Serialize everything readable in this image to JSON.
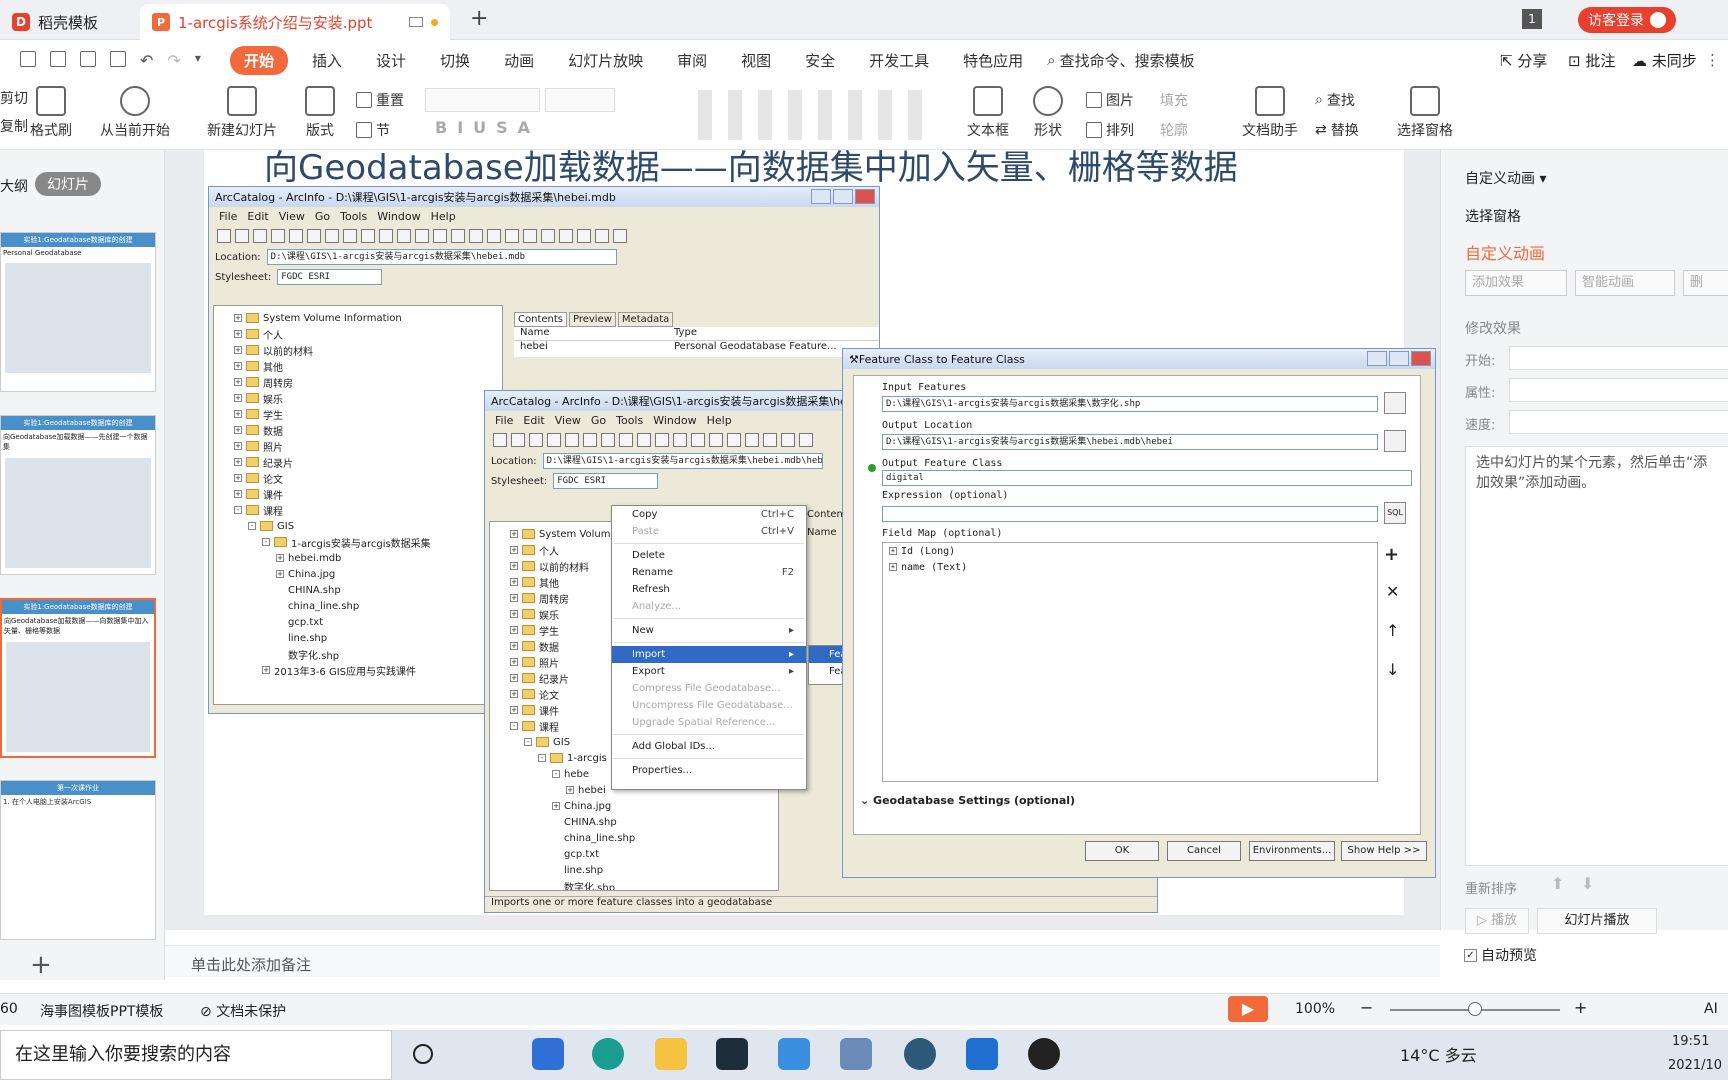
{
  "tabs": {
    "docer": "稻壳模板",
    "file": "1-arcgis系统介绍与安装.ppt",
    "badge": "1",
    "login": "访客登录"
  },
  "menu": {
    "start": "开始",
    "items": [
      "插入",
      "设计",
      "切换",
      "动画",
      "幻灯片放映",
      "审阅",
      "视图",
      "安全",
      "开发工具",
      "特色应用"
    ],
    "search": "查找命令、搜索模板",
    "share": "分享",
    "comment": "批注",
    "sync": "未同步"
  },
  "ribbon": {
    "cut": "剪切",
    "copy": "复制",
    "format_brush": "格式刷",
    "from_current": "从当前开始",
    "new_slide": "新建幻灯片",
    "layout": "版式",
    "reset": "重置",
    "section": "节",
    "textbox": "文本框",
    "shape": "形状",
    "picture": "图片",
    "arrange": "排列",
    "fill": "填充",
    "outline": "轮廓",
    "doc_helper": "文档助手",
    "find": "查找",
    "replace": "替换",
    "select_pane": "选择窗格"
  },
  "leftpanel": {
    "tab_outline": "大纲",
    "tab_slides": "幻灯片",
    "thumbs": [
      {
        "header": "实验1:Geodatabase数据库的创建",
        "sub": "Personal Geodatabase"
      },
      {
        "header": "实验1:Geodatabase数据库的创建",
        "sub": "向Geodatabase加载数据——先创建一个数据集"
      },
      {
        "header": "实验1:Geodatabase数据库的创建",
        "sub": "向Geodatabase加载数据——向数据集中加入矢量、栅格等数据"
      },
      {
        "header": "第一次课作业",
        "sub": "1. 在个人电脑上安装ArcGIS"
      }
    ],
    "add": "+"
  },
  "slide": {
    "title": "向Geodatabase加载数据——向数据集中加入矢量、栅格等数据"
  },
  "win1": {
    "title": "ArcCatalog - ArcInfo - D:\\课程\\GIS\\1-arcgis安装与arcgis数据采集\\hebei.mdb",
    "menu": [
      "File",
      "Edit",
      "View",
      "Go",
      "Tools",
      "Window",
      "Help"
    ],
    "location_label": "Location:",
    "location": "D:\\课程\\GIS\\1-arcgis安装与arcgis数据采集\\hebei.mdb",
    "stylesheet_label": "Stylesheet:",
    "stylesheet": "FGDC ESRI",
    "tabs": [
      "Contents",
      "Preview",
      "Metadata"
    ],
    "col_name": "Name",
    "col_type": "Type",
    "row_name": "hebei",
    "row_type": "Personal Geodatabase Feature...",
    "tree": [
      "System Volume Information",
      "个人",
      "以前的材料",
      "其他",
      "周转房",
      "娱乐",
      "学生",
      "数据",
      "照片",
      "纪录片",
      "论文",
      "课件",
      "课程",
      "GIS",
      "1-arcgis安装与arcgis数据采集",
      "hebei.mdb",
      "China.jpg",
      "CHINA.shp",
      "china_line.shp",
      "gcp.txt",
      "line.shp",
      "数字化.shp",
      "2013年3-6 GIS应用与实践课件"
    ]
  },
  "win2": {
    "title": "ArcCatalog - ArcInfo - D:\\课程\\GIS\\1-arcgis安装与arcgis数据采集\\hebei.m",
    "menu": [
      "File",
      "Edit",
      "View",
      "Go",
      "Tools",
      "Window",
      "Help"
    ],
    "location_label": "Location:",
    "location": "D:\\课程\\GIS\\1-arcgis安装与arcgis数据采集\\hebei.mdb\\hebei",
    "stylesheet_label": "Stylesheet:",
    "stylesheet": "FGDC ESRI",
    "contents_tab": "Contents",
    "name_col": "Name",
    "tree": [
      "System Volume",
      "个人",
      "以前的材料",
      "其他",
      "周转房",
      "娱乐",
      "学生",
      "数据",
      "照片",
      "纪录片",
      "论文",
      "课件",
      "课程",
      "GIS",
      "1-arcgis",
      "hebe",
      "hebei",
      "China.jpg",
      "CHINA.shp",
      "china_line.shp",
      "gcp.txt",
      "line.shp",
      "数字化.shp"
    ],
    "status": "Imports one or more feature classes into a geodatabase"
  },
  "ctx": {
    "copy": "Copy",
    "copy_sc": "Ctrl+C",
    "paste": "Paste",
    "paste_sc": "Ctrl+V",
    "delete": "Delete",
    "rename": "Rename",
    "rename_sc": "F2",
    "refresh": "Refresh",
    "analyze": "Analyze...",
    "new": "New",
    "import": "Import",
    "export": "Export",
    "compress": "Compress File Geodatabase...",
    "uncompress": "Uncompress File Geodatabase...",
    "upgrade": "Upgrade Spatial Reference...",
    "add_ids": "Add Global IDs...",
    "properties": "Properties...",
    "sub1": "Fea",
    "sub2": "Fea"
  },
  "dlg": {
    "title": "Feature Class to Feature Class",
    "input_label": "Input Features",
    "input": "D:\\课程\\GIS\\1-arcgis安装与arcgis数据采集\\数字化.shp",
    "outloc_label": "Output Location",
    "outloc": "D:\\课程\\GIS\\1-arcgis安装与arcgis数据采集\\hebei.mdb\\hebei",
    "outfc_label": "Output Feature Class",
    "outfc": "digital",
    "expr_label": "Expression (optional)",
    "fieldmap_label": "Field Map (optional)",
    "fields": [
      "Id (Long)",
      "name (Text)"
    ],
    "gdb_settings": "Geodatabase Settings (optional)",
    "ok": "OK",
    "cancel": "Cancel",
    "env": "Environments...",
    "help": "Show Help >>"
  },
  "rightpane": {
    "custom_anim_dd": "自定义动画",
    "select_pane": "选择窗格",
    "custom_anim": "自定义动画",
    "add_effect": "添加效果",
    "smart_anim": "智能动画",
    "delete": "删",
    "modify": "修改效果",
    "start": "开始:",
    "property": "属性:",
    "speed": "速度:",
    "hint": "选中幻灯片的某个元素，然后单击“添加效果”添加动画。",
    "reorder": "重新排序",
    "play": "播放",
    "slideshow": "幻灯片播放",
    "autopreview": "自动预览"
  },
  "notes": {
    "placeholder": "单击此处添加备注"
  },
  "status": {
    "page": "60",
    "template": "海事图模板PPT模板",
    "protect": "文档未保护",
    "zoom": "100%",
    "ai": "AI"
  },
  "taskbar": {
    "search": "在这里输入你要搜索的内容",
    "weather": "14°C 多云",
    "time": "19:51",
    "date": "2021/10"
  }
}
